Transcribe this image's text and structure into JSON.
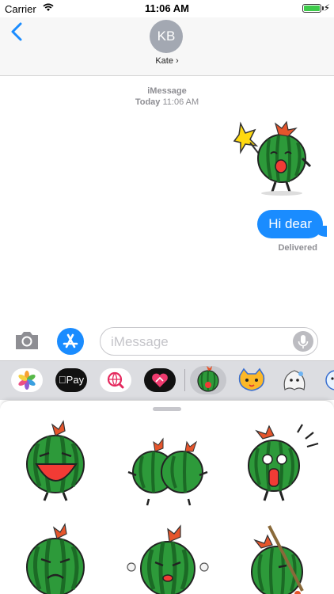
{
  "status": {
    "carrier": "Carrier",
    "time": "11:06 AM",
    "battery_level": 1.0,
    "charging": true
  },
  "header": {
    "avatar_initials": "KB",
    "contact_name": "Kate ›"
  },
  "conversation": {
    "service": "iMessage",
    "time_day": "Today",
    "time_clock": "11:06 AM",
    "sticker_message": "watermelon-with-leaf",
    "text_message": "Hi dear",
    "receipt": "Delivered"
  },
  "compose": {
    "placeholder": "iMessage"
  },
  "app_drawer": {
    "pay_label": "Pay",
    "apps": [
      "photos",
      "apple-pay",
      "web-search",
      "digital-touch",
      "watermelon-stickers",
      "cat-stickers",
      "ghost-stickers"
    ]
  },
  "sticker_grid": [
    "laughing",
    "hugging",
    "shocked",
    "crying",
    "sad",
    "samurai"
  ],
  "colors": {
    "accent": "#1a8cff",
    "watermelon_green": "#2d9a3a",
    "leaf": "#e5552c"
  }
}
